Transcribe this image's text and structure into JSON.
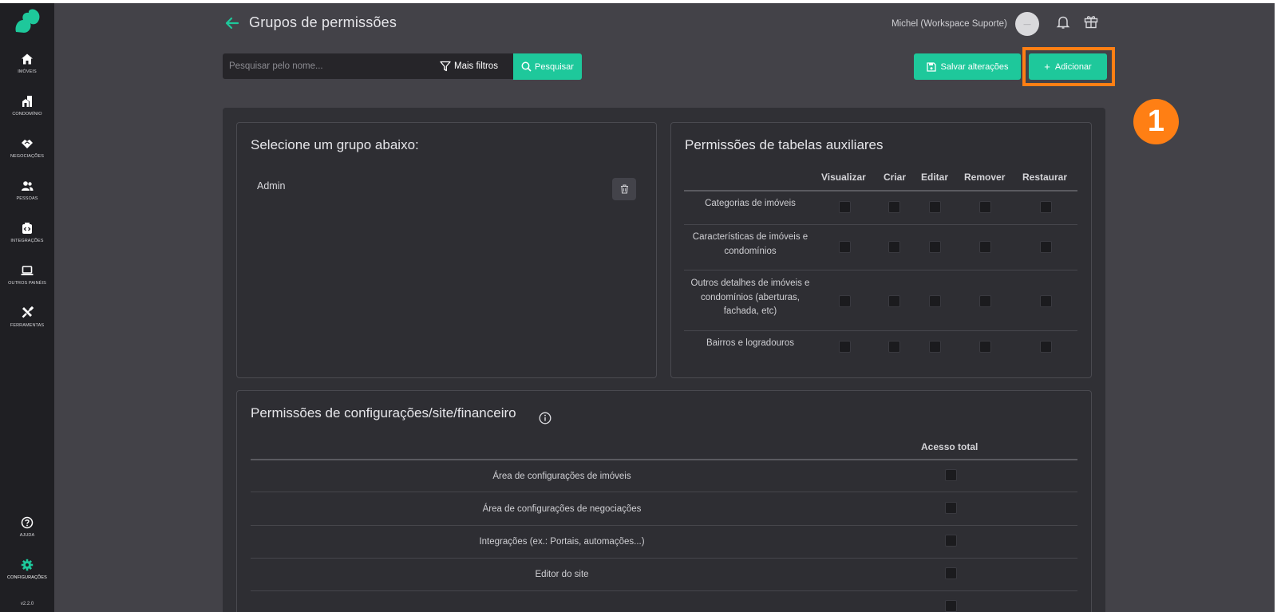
{
  "sidebar": {
    "items": [
      {
        "label": "IMÓVEIS",
        "icon": "home-icon"
      },
      {
        "label": "CONDOMÍNIO",
        "icon": "building-icon"
      },
      {
        "label": "NEGOCIAÇÕES",
        "icon": "handshake-icon"
      },
      {
        "label": "PESSOAS",
        "icon": "people-icon"
      },
      {
        "label": "INTEGRAÇÕES",
        "icon": "integration-icon"
      },
      {
        "label": "OUTROS PAINÉIS",
        "icon": "laptop-icon"
      },
      {
        "label": "FERRAMENTAS",
        "icon": "tools-icon"
      }
    ],
    "help_label": "AJUDA",
    "settings_label": "CONFIGURAÇÕES",
    "version": "v2.2.0"
  },
  "header": {
    "title": "Grupos de permissões",
    "user_name": "Michel (Workspace Suporte)",
    "avatar_text": "—"
  },
  "toolbar": {
    "search_placeholder": "Pesquisar pelo nome...",
    "filters_label": "Mais filtros",
    "search_label": "Pesquisar",
    "save_label": "Salvar alterações",
    "add_label": "Adicionar",
    "add_plus": "+"
  },
  "annotation": {
    "step": "1"
  },
  "groups": {
    "title": "Selecione um grupo abaixo:",
    "items": [
      "Admin"
    ]
  },
  "aux_permissions": {
    "title": "Permissões de tabelas auxiliares",
    "columns": [
      "Visualizar",
      "Criar",
      "Editar",
      "Remover",
      "Restaurar"
    ],
    "rows": [
      "Categorias de imóveis",
      "Características de imóveis e condomínios",
      "Outros detalhes de imóveis e condomínios (aberturas, fachada, etc)",
      "Bairros e logradouros"
    ]
  },
  "config_permissions": {
    "title": "Permissões de configurações/site/financeiro",
    "column": "Acesso total",
    "rows": [
      "Área de configurações de imóveis",
      "Área de configurações de negociações",
      "Integrações (ex.: Portais, automações...)",
      "Editor do site"
    ]
  },
  "colors": {
    "accent": "#1ec89b",
    "highlight": "#ff7f14",
    "sidebar_bg": "#1f1f23",
    "app_bg": "#434248"
  }
}
